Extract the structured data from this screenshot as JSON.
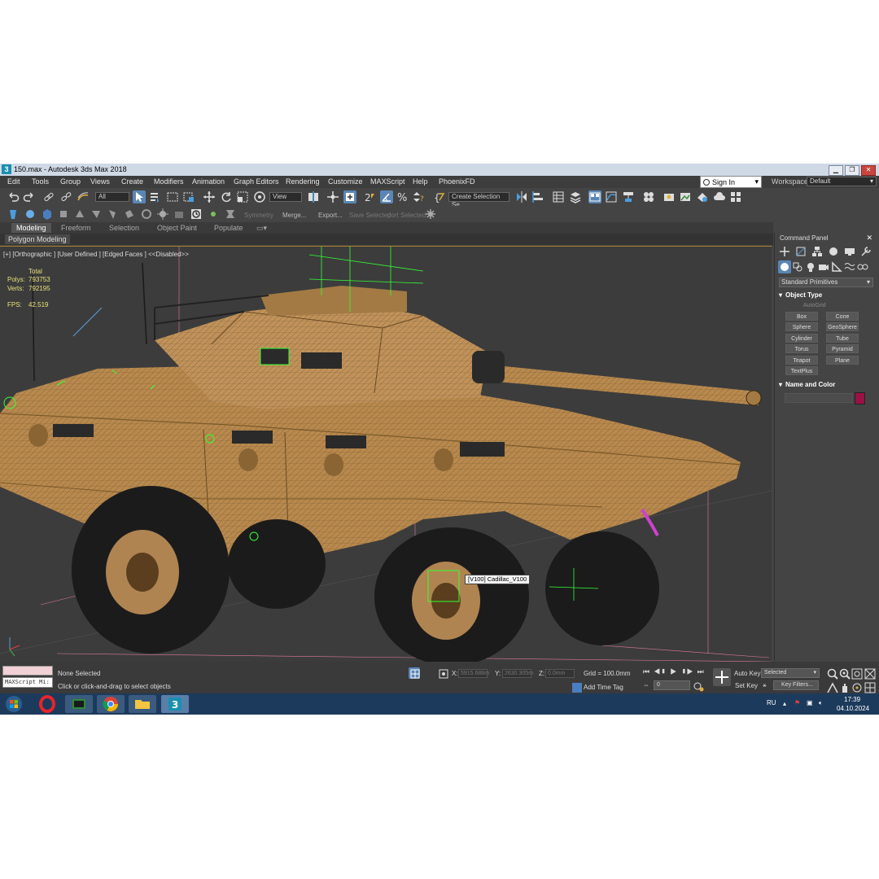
{
  "window": {
    "title": "150.max - Autodesk 3ds Max 2018",
    "app_icon": "3",
    "controls": [
      "minimize-icon",
      "maximize-icon",
      "close-icon"
    ]
  },
  "menu": [
    "Edit",
    "Tools",
    "Group",
    "Views",
    "Create",
    "Modifiers",
    "Animation",
    "Graph Editors",
    "Rendering",
    "Customize",
    "MAXScript",
    "Help",
    "PhoenixFD"
  ],
  "account": {
    "signin": "Sign In",
    "workspaces_label": "Workspaces:",
    "workspace": "Default"
  },
  "toolbar": {
    "selection_filter": "All",
    "reference_coord": "View",
    "named_selection": "Create Selection Se",
    "symmetry": "Symmetry",
    "merge": "Merge...",
    "export": "Export...",
    "save_selected": "Save Selected",
    "port_selected": "port Selected."
  },
  "ribbon": {
    "tabs": [
      "Modeling",
      "Freeform",
      "Selection",
      "Object Paint",
      "Populate"
    ],
    "active_tab": "Modeling",
    "sub": "Polygon Modeling"
  },
  "viewport": {
    "label": "[+] [Orthographic ] [User Defined ] [Edged Faces ]  <<Disabled>>",
    "stats": {
      "header": "Total",
      "polys_label": "Polys:",
      "polys": "793753",
      "verts_label": "Verts:",
      "verts": "792195",
      "fps_label": "FPS:",
      "fps": "42.519"
    },
    "object_tooltip": "[V100] Cadillac_V100",
    "colors": {
      "background": "#3c3c3c",
      "vehicle": "#b8894e",
      "helpers": "#33ff33"
    }
  },
  "command_panel": {
    "title": "Command Panel",
    "category": "Standard Primitives",
    "object_type_header": "Object Type",
    "autogrid": "AutoGrid",
    "primitives": [
      "Box",
      "Cone",
      "Sphere",
      "GeoSphere",
      "Cylinder",
      "Tube",
      "Torus",
      "Pyramid",
      "Teapot",
      "Plane",
      "TextPlus"
    ],
    "name_color_header": "Name and Color",
    "object_color": "#9a1245"
  },
  "status": {
    "maxscript": "MAXScript Mi:",
    "selection": "None Selected",
    "prompt": "Click or click-and-drag to select objects",
    "x_label": "X:",
    "x": "5915.688m",
    "y_label": "Y:",
    "y": "2630.305m",
    "z_label": "Z:",
    "z": "0.0mm",
    "grid": "Grid = 100.0mm",
    "add_time_tag": "Add Time Tag",
    "auto_key": "Auto Key",
    "set_key": "Set Key",
    "key_mode": "Selected",
    "key_filters": "Key Filters...",
    "frame": "0"
  },
  "taskbar": {
    "apps": [
      "windows-start",
      "opera",
      "gpu-monitor",
      "chrome",
      "file-explorer",
      "3ds-max"
    ],
    "language": "RU",
    "time": "17:39",
    "date": "04.10.2024"
  }
}
